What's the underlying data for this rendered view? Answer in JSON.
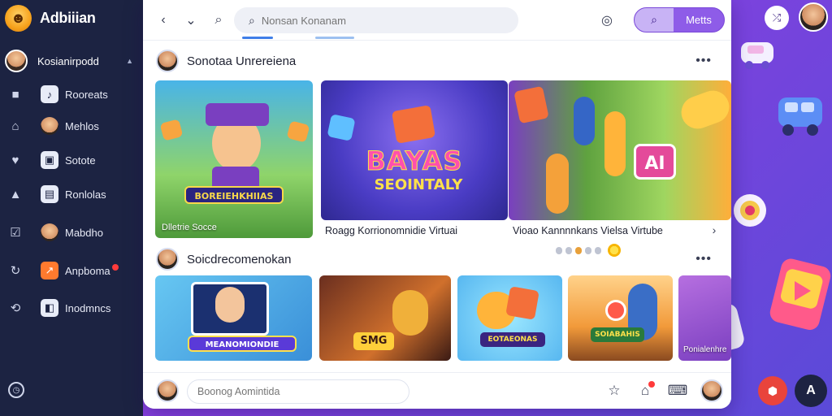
{
  "sidebar": {
    "brand": "Adbiiian",
    "profile_name": "Kosianirpodd",
    "items": [
      {
        "label": "Rooreats",
        "icon": "note-icon"
      },
      {
        "label": "Mehlos",
        "icon": "face-icon"
      },
      {
        "label": "Sotote",
        "icon": "grid-icon"
      },
      {
        "label": "Ronlolas",
        "icon": "page-icon"
      },
      {
        "label": "Mabdho",
        "icon": "face-icon"
      },
      {
        "label": "Anpboma",
        "icon": "arrow-icon"
      },
      {
        "label": "Inodmncs",
        "icon": "square-icon"
      }
    ]
  },
  "toolbar": {
    "search_placeholder": "Nonsan Konanam",
    "action_label": "Metts"
  },
  "section1": {
    "title": "Sonotaa Unrereiena",
    "cards": [
      {
        "banner": "BOREIEHKHIIAS",
        "overlay": "Dlletrie Socce"
      },
      {
        "banner": "BAYAS",
        "banner2": "SEOINTALY",
        "caption": "Roagg Korrionomnidie Virtuai"
      },
      {
        "banner": "AI",
        "caption": "Vioao Kannnnkans Vielsa Virtube"
      }
    ]
  },
  "section2": {
    "title": "Soicdrecomenokan",
    "cards": [
      {
        "banner": "MEANOMIONDIE"
      },
      {
        "banner": "SMG"
      },
      {
        "banner": "EOTAEONAS"
      },
      {
        "banner": "SOIABAHIS"
      },
      {
        "overlay": "Ponialenhre"
      }
    ]
  },
  "bottom": {
    "comment_placeholder": "Boonog Aomintida"
  },
  "colors": {
    "sidebar_bg": "#1c2342",
    "accent_purple": "#8e5ce8",
    "background_gradient": "#c23fd6"
  }
}
